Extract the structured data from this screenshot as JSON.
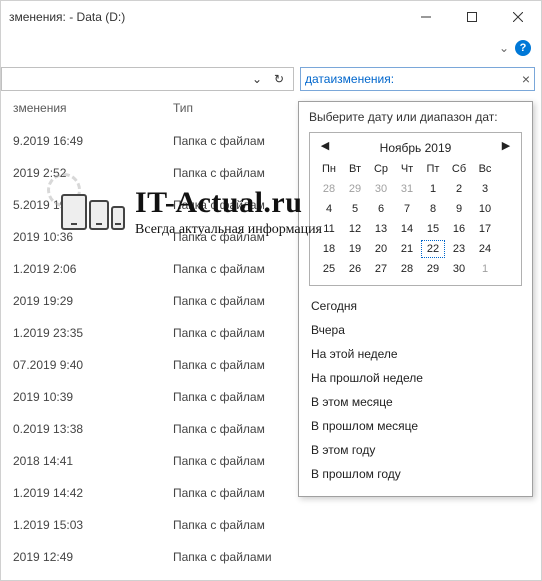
{
  "window": {
    "title": "зменения: - Data (D:)"
  },
  "search": {
    "term": "датаизменения:"
  },
  "columns": {
    "date": "зменения",
    "type": "Тип"
  },
  "files": [
    {
      "date": "9.2019 16:49",
      "type": "Папка с файлам"
    },
    {
      "date": "2019 2:52",
      "type": "Папка с файлам"
    },
    {
      "date": "5.2019 19:37",
      "type": "Папка с файлам"
    },
    {
      "date": "2019 10:36",
      "type": "Папка с файлам"
    },
    {
      "date": "1.2019 2:06",
      "type": "Папка с файлам"
    },
    {
      "date": "2019 19:29",
      "type": "Папка с файлам"
    },
    {
      "date": "1.2019 23:35",
      "type": "Папка с файлам"
    },
    {
      "date": "07.2019 9:40",
      "type": "Папка с файлам"
    },
    {
      "date": "2019 10:39",
      "type": "Папка с файлам"
    },
    {
      "date": "0.2019 13:38",
      "type": "Папка с файлам"
    },
    {
      "date": "2018 14:41",
      "type": "Папка с файлам"
    },
    {
      "date": "1.2019 14:42",
      "type": "Папка с файлам"
    },
    {
      "date": "1.2019 15:03",
      "type": "Папка с файлам"
    },
    {
      "date": "2019 12:49",
      "type": "Папка с файлами"
    }
  ],
  "dropdown": {
    "caption": "Выберите дату или диапазон дат:",
    "calendar": {
      "month_label": "Ноябрь 2019",
      "weekdays": [
        "Пн",
        "Вт",
        "Ср",
        "Чт",
        "Пт",
        "Сб",
        "Вс"
      ],
      "leading_gray": [
        28,
        29,
        30,
        31
      ],
      "days": [
        1,
        2,
        3,
        4,
        5,
        6,
        7,
        8,
        9,
        10,
        11,
        12,
        13,
        14,
        15,
        16,
        17,
        18,
        19,
        20,
        21,
        22,
        23,
        24,
        25,
        26,
        27,
        28,
        29,
        30
      ],
      "trailing_gray": [
        1
      ],
      "today": 22
    },
    "presets": [
      "Сегодня",
      "Вчера",
      "На этой неделе",
      "На прошлой неделе",
      "В этом месяце",
      "В прошлом месяце",
      "В этом году",
      "В прошлом году"
    ]
  },
  "watermark": {
    "main": "IT-Actual.ru",
    "sub": "Всегда актуальная информация"
  }
}
